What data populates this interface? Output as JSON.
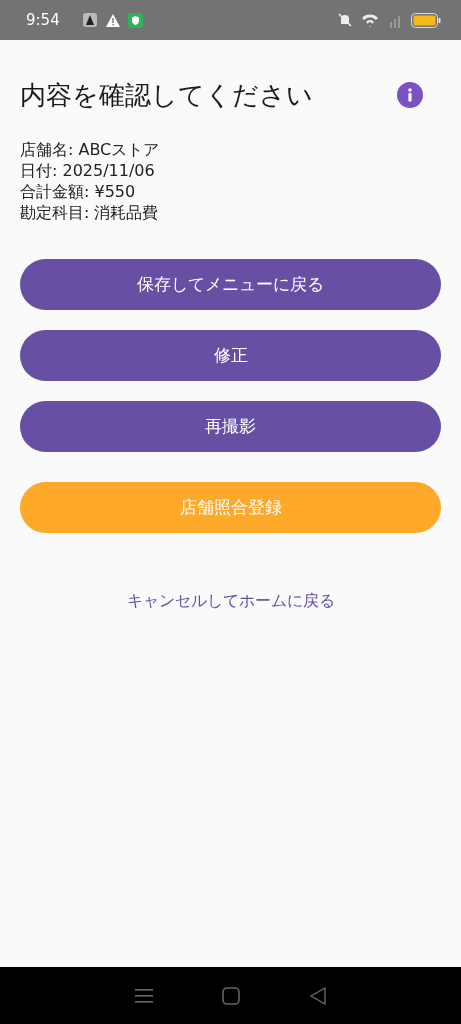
{
  "status_bar": {
    "time": "9:54"
  },
  "title": "内容を確認してください",
  "details": [
    "店舗名: ABCストア",
    "日付: 2025/11/06",
    "合計金額: ¥550",
    "勘定科目: 消耗品費"
  ],
  "buttons": [
    {
      "label": "保存してメニューに戻る",
      "kind": "primary"
    },
    {
      "label": "修正",
      "kind": "primary"
    },
    {
      "label": "再撮影",
      "kind": "primary"
    },
    {
      "label": "店舗照合登録",
      "kind": "accent"
    }
  ],
  "cancel_link": "キャンセルしてホームに戻る"
}
